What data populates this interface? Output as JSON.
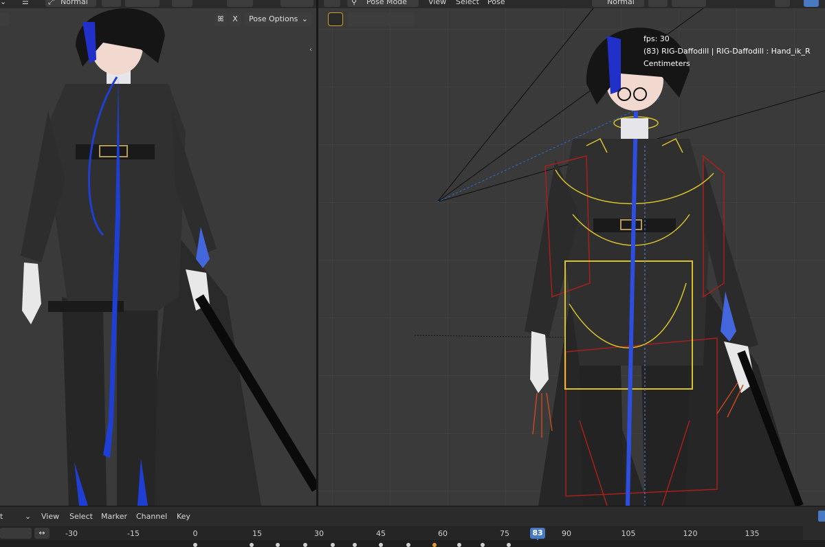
{
  "left_header": {
    "shading_label": "Normal"
  },
  "right_header": {
    "mode_label": "Pose Mode",
    "menu_view": "View",
    "menu_select": "Select",
    "menu_pose": "Pose",
    "shading_label": "Normal"
  },
  "left_viewport": {
    "close_label": "X",
    "pose_options_label": "Pose Options"
  },
  "right_viewport": {
    "fps": "fps: 30",
    "object_info": "(83) RIG-Daffodill | RIG-Daffodill : Hand_ik_R",
    "units": "Centimeters"
  },
  "timeline": {
    "menu_view": "View",
    "menu_select": "Select",
    "menu_marker": "Marker",
    "menu_channel": "Channel",
    "menu_key": "Key",
    "current_frame": "83",
    "ruler": [
      "-30",
      "-15",
      "0",
      "15",
      "30",
      "45",
      "60",
      "75",
      "90",
      "105",
      "120",
      "135"
    ]
  },
  "colors": {
    "accent": "#4a79c4",
    "viewport_bg": "#3a3a3a",
    "rig_yellow": "#d9c22a",
    "rig_red": "#a8201c",
    "hair_blue": "#1f3fd4"
  }
}
